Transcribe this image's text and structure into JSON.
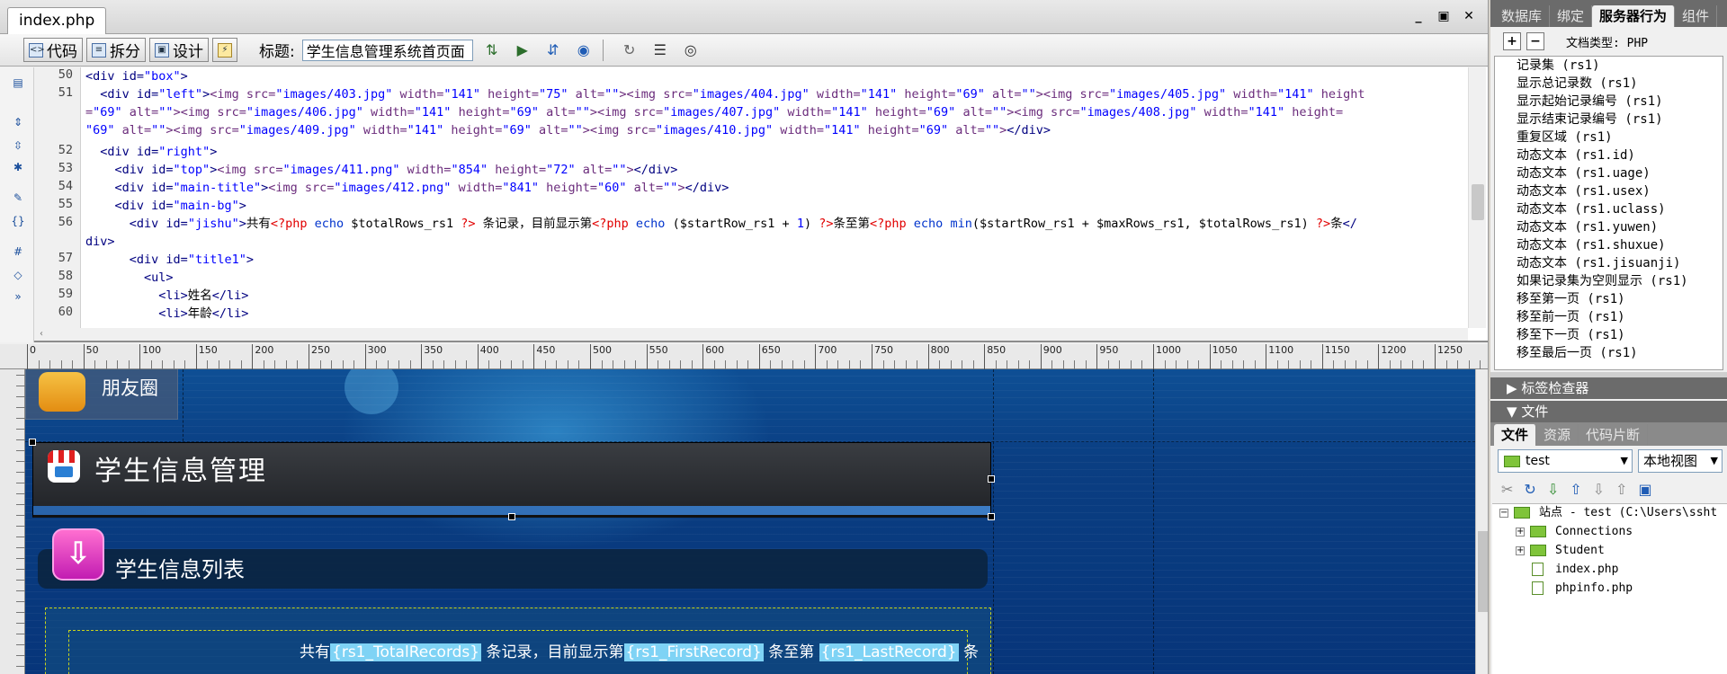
{
  "document": {
    "filename": "index.php",
    "window_controls": [
      "_",
      "▣",
      "✕"
    ]
  },
  "toolbar": {
    "code_label": "代码",
    "split_label": "拆分",
    "design_label": "设计",
    "title_label": "标题:",
    "title_value": "学生信息管理系统首页面"
  },
  "code": {
    "line_numbers": [
      "50",
      "51",
      "",
      "",
      "52",
      "53",
      "54",
      "55",
      "56",
      "",
      "57",
      "58",
      "59",
      "60"
    ]
  },
  "design": {
    "ruler_labels": [
      "0",
      "50",
      "100",
      "150",
      "200",
      "250",
      "300",
      "350",
      "400",
      "450",
      "500",
      "550",
      "600",
      "650",
      "700",
      "750",
      "800",
      "850",
      "900",
      "950",
      "1000",
      "1050",
      "1100",
      "1150",
      "1200",
      "1250"
    ],
    "friends_label": "朋友圈",
    "header_title": "学生信息管理",
    "list_title": "学生信息列表",
    "count_prefix": "共有",
    "total_records": "{rs1_TotalRecords}",
    "count_mid1": " 条记录，目前显示第",
    "first_record": "{rs1_FirstRecord}",
    "count_mid2": " 条至第 ",
    "last_record": "{rs1_LastRecord}",
    "count_suffix": " 条"
  },
  "panels": {
    "tabs": [
      "数据库",
      "绑定",
      "服务器行为",
      "组件"
    ],
    "active_tab": "服务器行为",
    "doctype": "文档类型: PHP",
    "server_behaviors": [
      "记录集 (rs1)",
      "显示总记录数 (rs1)",
      "显示起始记录编号 (rs1)",
      "显示结束记录编号 (rs1)",
      "重复区域 (rs1)",
      "动态文本 (rs1.id)",
      "动态文本 (rs1.uage)",
      "动态文本 (rs1.usex)",
      "动态文本 (rs1.uclass)",
      "动态文本 (rs1.yuwen)",
      "动态文本 (rs1.shuxue)",
      "动态文本 (rs1.jisuanji)",
      "如果记录集为空则显示 (rs1)",
      "移至第一页 (rs1)",
      "移至前一页 (rs1)",
      "移至下一页 (rs1)",
      "移至最后一页 (rs1)"
    ],
    "tag_inspector": "标签检查器",
    "files_header": "文件",
    "file_tabs": [
      "文件",
      "资源",
      "代码片断"
    ],
    "site_select": "test",
    "view_select": "本地视图",
    "tree": [
      "站点 - test (C:\\Users\\ssht",
      "Connections",
      "Student",
      "index.php",
      "phpinfo.php"
    ]
  }
}
